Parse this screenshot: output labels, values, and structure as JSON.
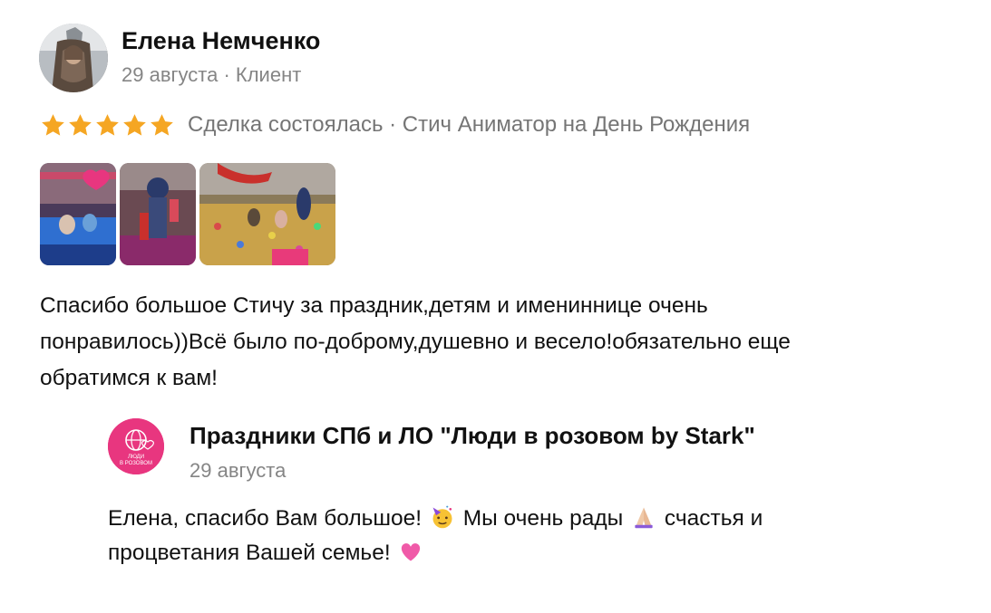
{
  "review": {
    "author": {
      "name": "Елена Немченко",
      "meta": "29 августа · Клиент"
    },
    "rating": 5,
    "deal_text": "Сделка состоялась · Стич Аниматор на День Рождения",
    "photos_count": 3,
    "text_lines": [
      "Спасибо большое Стичу за праздник,детям и имениннице очень",
      "понравилось))Всё было по-доброму,душевно и весело!обязательно еще",
      "обратимся к вам!"
    ]
  },
  "reply": {
    "author_name": "Праздники СПб и ЛО \"Люди в розовом by Stark\"",
    "avatar_text": "ЛЮДИ В РОЗОВОМ",
    "date": "29 августа",
    "line1_part1": "Елена, спасибо Вам большое!",
    "line1_part2": "Мы очень рады",
    "line1_part3": "счастья и",
    "line2": "процветания Вашей семье!",
    "emojis": [
      "party-face-icon",
      "praying-hands-icon",
      "pink-heart-icon"
    ]
  },
  "colors": {
    "star": "#F5A623",
    "muted_text": "#858585",
    "brand_pink": "#E8367F"
  }
}
